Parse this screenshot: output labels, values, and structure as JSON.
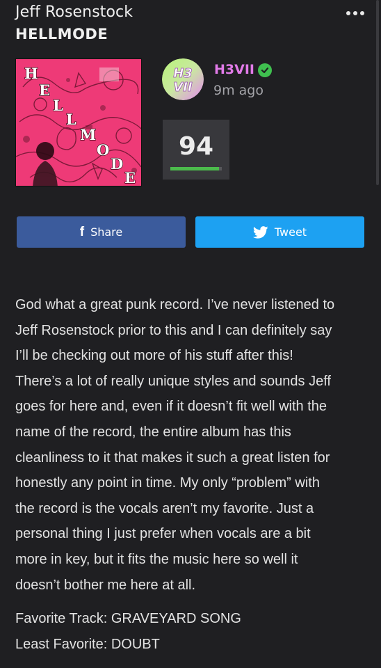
{
  "header": {
    "artist": "Jeff Rosenstock",
    "album": "HELLMODE",
    "more_icon": "more-horizontal-icon"
  },
  "cover_art": {
    "letters": [
      "H",
      "E",
      "L",
      "L",
      "M",
      "O",
      "D",
      "E"
    ],
    "background_color": "#ee3a77"
  },
  "user": {
    "name": "H3VII",
    "avatar_text": "H3 VII",
    "posted": "9m ago",
    "verified_icon": "verified-check-icon",
    "name_color": "#e27be9"
  },
  "rating": {
    "score": "94",
    "fill_fraction": 0.94,
    "bar_color": "#4cbb4c"
  },
  "actions": {
    "share_label": "Share",
    "tweet_label": "Tweet",
    "share_icon": "facebook-icon",
    "tweet_icon": "twitter-bird-icon"
  },
  "review": {
    "lines": [
      "God what a great punk record. I’ve never listened to",
      "Jeff Rosenstock prior to this and I can definitely say",
      "I’ll be checking out more of his stuff after this!",
      "There’s a lot of really unique styles and sounds Jeff",
      "goes for here and, even if it doesn’t fit well with the",
      "name of the record, the entire album has this",
      "cleanliness to it that makes it such a great listen for",
      "honestly any point in time. My only “problem” with",
      "the record is the vocals aren’t my favorite. Just a",
      "personal thing I just prefer when vocals are a bit",
      "more in key, but it fits the music here so well it",
      "doesn’t bother me here at all."
    ],
    "favorite_track": "Favorite Track: GRAVEYARD SONG",
    "least_favorite": "Least Favorite: DOUBT"
  }
}
